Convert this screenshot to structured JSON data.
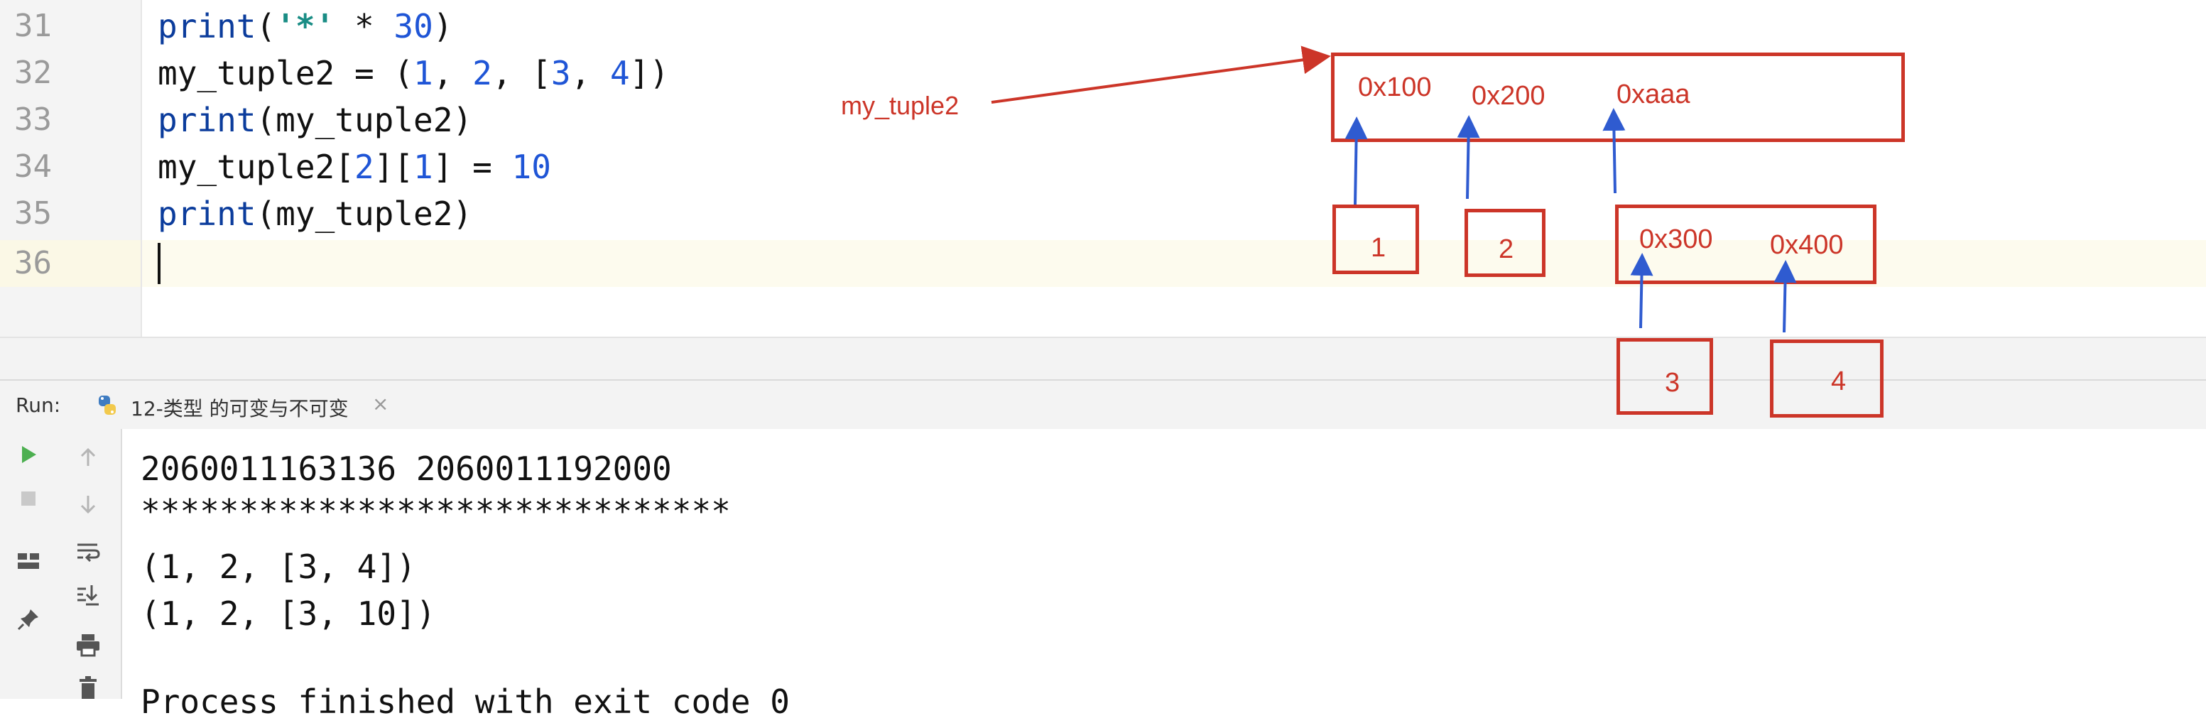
{
  "editor": {
    "lines": [
      {
        "no": "31",
        "code": "print('*' * 30)"
      },
      {
        "no": "32",
        "code": "my_tuple2 = (1, 2, [3, 4])"
      },
      {
        "no": "33",
        "code": "print(my_tuple2)"
      },
      {
        "no": "34",
        "code": "my_tuple2[2][1] = 10"
      },
      {
        "no": "35",
        "code": "print(my_tuple2)"
      },
      {
        "no": "36",
        "code": ""
      }
    ]
  },
  "run": {
    "label": "Run:",
    "tab_title": "12-类型 的可变与不可变",
    "tab_close": "×"
  },
  "console": {
    "lines": [
      "2060011163136 2060011192000",
      "******************************",
      "(1, 2, [3, 4])",
      "(1, 2, [3, 10])",
      "",
      "Process finished with exit code 0"
    ]
  },
  "annotations": {
    "variable_label": "my_tuple2",
    "tuple_addresses": [
      "0x100",
      "0x200",
      "0xaaa"
    ],
    "values": [
      "1",
      "2",
      "3",
      "4"
    ],
    "list_addresses": [
      "0x300",
      "0x400"
    ],
    "colors": {
      "box": "#cc3528",
      "pointer": "#2f5bd0"
    }
  },
  "icons": [
    "run-icon",
    "stop-icon",
    "layout-icon",
    "pin-icon",
    "up-arrow-icon",
    "down-arrow-icon",
    "soft-wrap-icon",
    "scroll-to-end-icon",
    "print-icon",
    "trash-icon",
    "python-icon"
  ]
}
